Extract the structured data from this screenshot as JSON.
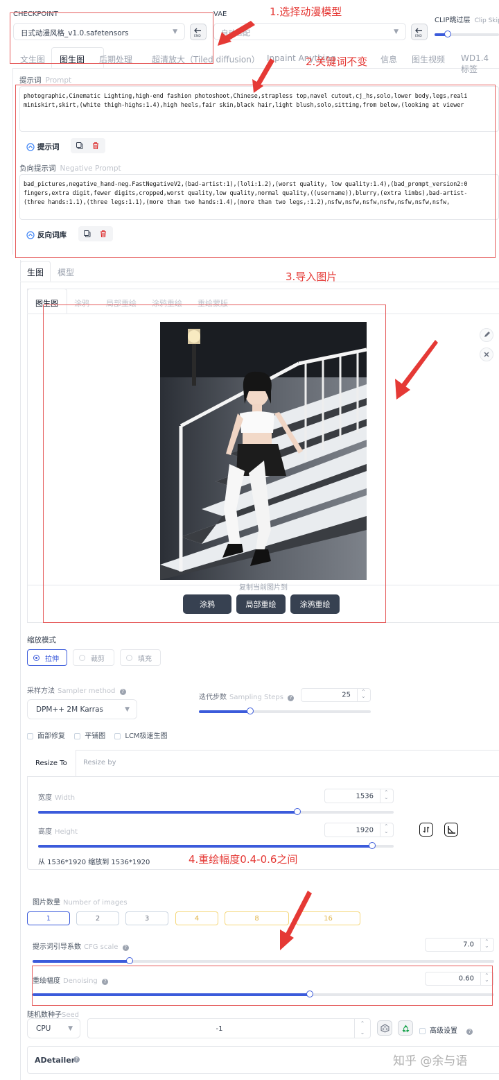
{
  "header": {
    "checkpoint_label": "CHECKPOINT",
    "checkpoint_value": "日式动漫风格_v1.0.safetensors",
    "vae_label": "VAE",
    "vae_value": "自动匹配",
    "clip_label": "CLIP跳过层",
    "clip_sub": "Clip Skip",
    "end_icon_text": "END"
  },
  "main_tabs": [
    "文生图",
    "图生图",
    "后期处理",
    "超清放大（Tiled diffusion）",
    "Inpaint Anything",
    "信息",
    "图生视频",
    "WD1.4 标签"
  ],
  "prompt": {
    "label": "提示词",
    "label_en": "Prompt",
    "text": "photographic,Cinematic Lighting,high-end fashion photoshoot,Chinese,strapless top,navel cutout,cj_hs,solo,lower body,legs,reali\nminiskirt,skirt,(white thigh-highs:1.4),high heels,fair skin,black hair,light blush,solo,sitting,from below,(looking at viewer",
    "lib_label": "提示词"
  },
  "negative": {
    "label": "负向提示词",
    "label_en": "Negative Prompt",
    "text": "bad_pictures,negative_hand-neg.FastNegativeV2,(bad-artist:1),(loli:1.2),(worst quality, low quality:1.4),(bad_prompt_version2:0\nfingers,extra digit,fewer digits,cropped,worst quality,low quality,normal quality,((username)),blurry,(extra limbs),bad-artist-\n(three hands:1.1),(three legs:1.1),(more than two hands:1.4),(more than two legs,:1.2),nsfw,nsfw,nsfw,nsfw,nsfw,nsfw,nsfw,",
    "lib_label": "反向词库"
  },
  "sub_tabs": [
    "生图",
    "模型"
  ],
  "img_tabs": [
    "图生图",
    "涂鸦",
    "局部重绘",
    "涂鸦重绘",
    "重绘蒙版"
  ],
  "copy_label": "复制当前图片到",
  "copy_buttons": [
    "涂鸦",
    "局部重绘",
    "涂鸦重绘"
  ],
  "resize_mode": {
    "label": "缩放模式",
    "options": [
      "拉伸",
      "裁剪",
      "填充"
    ],
    "selected": "拉伸"
  },
  "sampler": {
    "label": "采样方法",
    "label_en": "Sampler method",
    "value": "DPM++ 2M Karras"
  },
  "steps": {
    "label": "迭代步数",
    "label_en": "Sampling Steps",
    "value": "25",
    "fraction": 0.3
  },
  "checkboxes": [
    "面部修复",
    "平铺图",
    "LCM极速生图"
  ],
  "resize_tabs": [
    "Resize To",
    "Resize by"
  ],
  "width": {
    "label": "宽度",
    "label_en": "Width",
    "value": "1536",
    "fraction": 0.73
  },
  "height": {
    "label": "高度",
    "label_en": "Height",
    "value": "1920",
    "fraction": 0.94
  },
  "resize_note": "从 1536*1920 缩放到 1536*1920",
  "batch": {
    "label": "图片数量",
    "label_en": "Number of images",
    "options": [
      "1",
      "2",
      "3",
      "4",
      "8",
      "16"
    ]
  },
  "cfg": {
    "label": "提示词引导系数",
    "label_en": "CFG scale",
    "value": "7.0",
    "fraction": 0.21
  },
  "denoise": {
    "label": "重绘幅度",
    "label_en": "Denoising",
    "value": "0.60",
    "fraction": 0.6
  },
  "seed": {
    "label": "随机数种子",
    "label_en": "Seed",
    "device": "CPU",
    "value": "-1",
    "advanced_label": "高级设置"
  },
  "adetailer_label": "ADetailer",
  "annotations": {
    "a1": "1.选择动漫模型",
    "a2": "2.关键词不变",
    "a3": "3.导入图片",
    "a4": "4.重绘幅度0.4-0.6之间"
  },
  "watermark": "知乎 @余与语",
  "colors": {
    "accent": "#3b5bdb",
    "annotation": "#e53935",
    "dark_button": "#374151"
  }
}
